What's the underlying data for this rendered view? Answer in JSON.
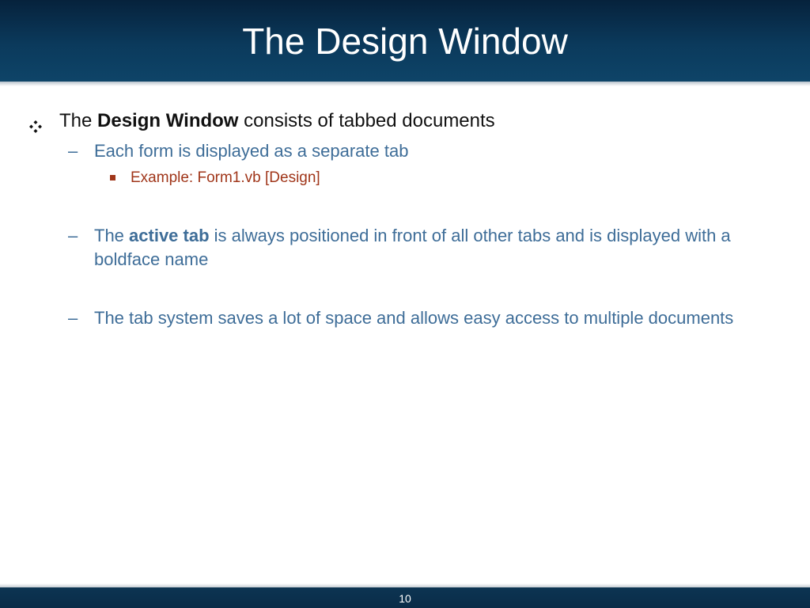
{
  "slide": {
    "title": "The Design Window",
    "page_number": "10"
  },
  "bullets": {
    "level1": {
      "pre": "The ",
      "bold": "Design Window",
      "post": " consists of tabbed documents"
    },
    "sub1": {
      "dash": "–",
      "text": "Each form is displayed as a separate tab"
    },
    "example": {
      "text": "Example: Form1.vb [Design]"
    },
    "sub2": {
      "dash": "–",
      "pre": "The ",
      "bold": "active tab",
      "post": " is always positioned in front of all other tabs and is displayed with a boldface name"
    },
    "sub3": {
      "dash": "–",
      "text": "The tab system saves a lot of space and allows easy access to multiple documents"
    }
  },
  "colors": {
    "title_bar": "#0b3a5c",
    "sub_bullet_text": "#3e6d98",
    "example_text": "#a0361a"
  },
  "icons": {
    "level1_marker": "four-diamond-bullet-icon",
    "level3_marker": "square-bullet-icon"
  }
}
